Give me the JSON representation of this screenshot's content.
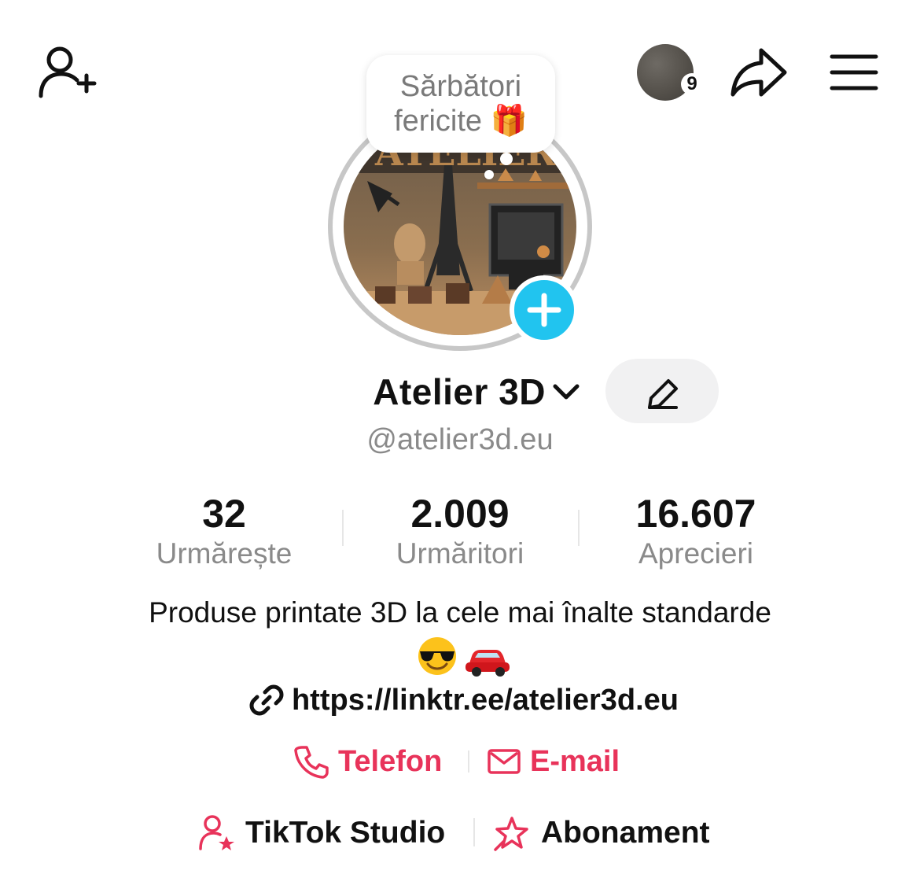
{
  "header": {
    "add_friend_icon": "person-plus-icon",
    "notifications": {
      "count": "9"
    },
    "share_icon": "share-arrow-icon",
    "menu_icon": "hamburger-menu-icon"
  },
  "profile": {
    "status_note": "Sărbători fericite 🎁",
    "display_name": "Atelier 3D",
    "username": "@atelier3d.eu",
    "add_photo_icon": "plus-icon",
    "edit_icon": "pencil-icon"
  },
  "stats": [
    {
      "value": "32",
      "label": "Urmărește"
    },
    {
      "value": "2.009",
      "label": "Urmăritori"
    },
    {
      "value": "16.607",
      "label": "Aprecieri"
    }
  ],
  "bio": {
    "text": "Produse printate 3D la cele mai înalte standarde",
    "emojis": [
      "smiling-face-with-sunglasses-emoji",
      "red-car-emoji"
    ],
    "link": "https://linktr.ee/atelier3d.eu"
  },
  "contacts": {
    "phone_label": "Telefon",
    "email_label": "E-mail"
  },
  "tools": {
    "studio_label": "TikTok Studio",
    "subscription_label": "Abonament"
  },
  "colors": {
    "accent": "#e8335a",
    "add_photo": "#21c4ef",
    "secondary_text": "#8a8a8a"
  }
}
